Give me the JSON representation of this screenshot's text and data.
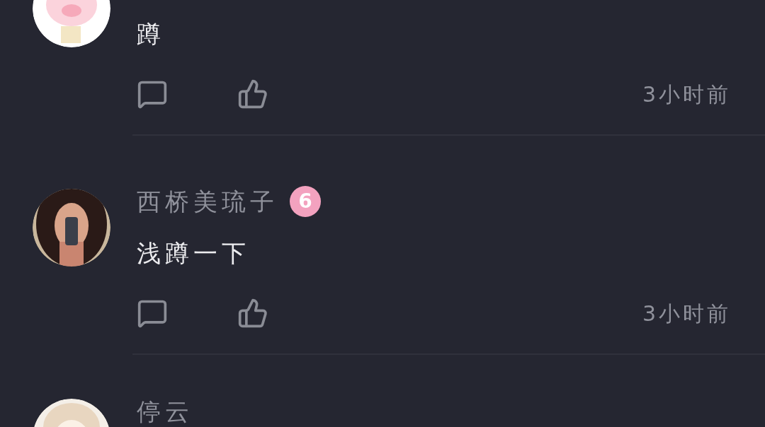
{
  "comments": [
    {
      "body": "蹲",
      "time": "3小时前"
    },
    {
      "name": "西桥美琉子",
      "level_badge": "6",
      "body": "浅蹲一下",
      "time": "3小时前"
    },
    {
      "name": "停云"
    }
  ]
}
